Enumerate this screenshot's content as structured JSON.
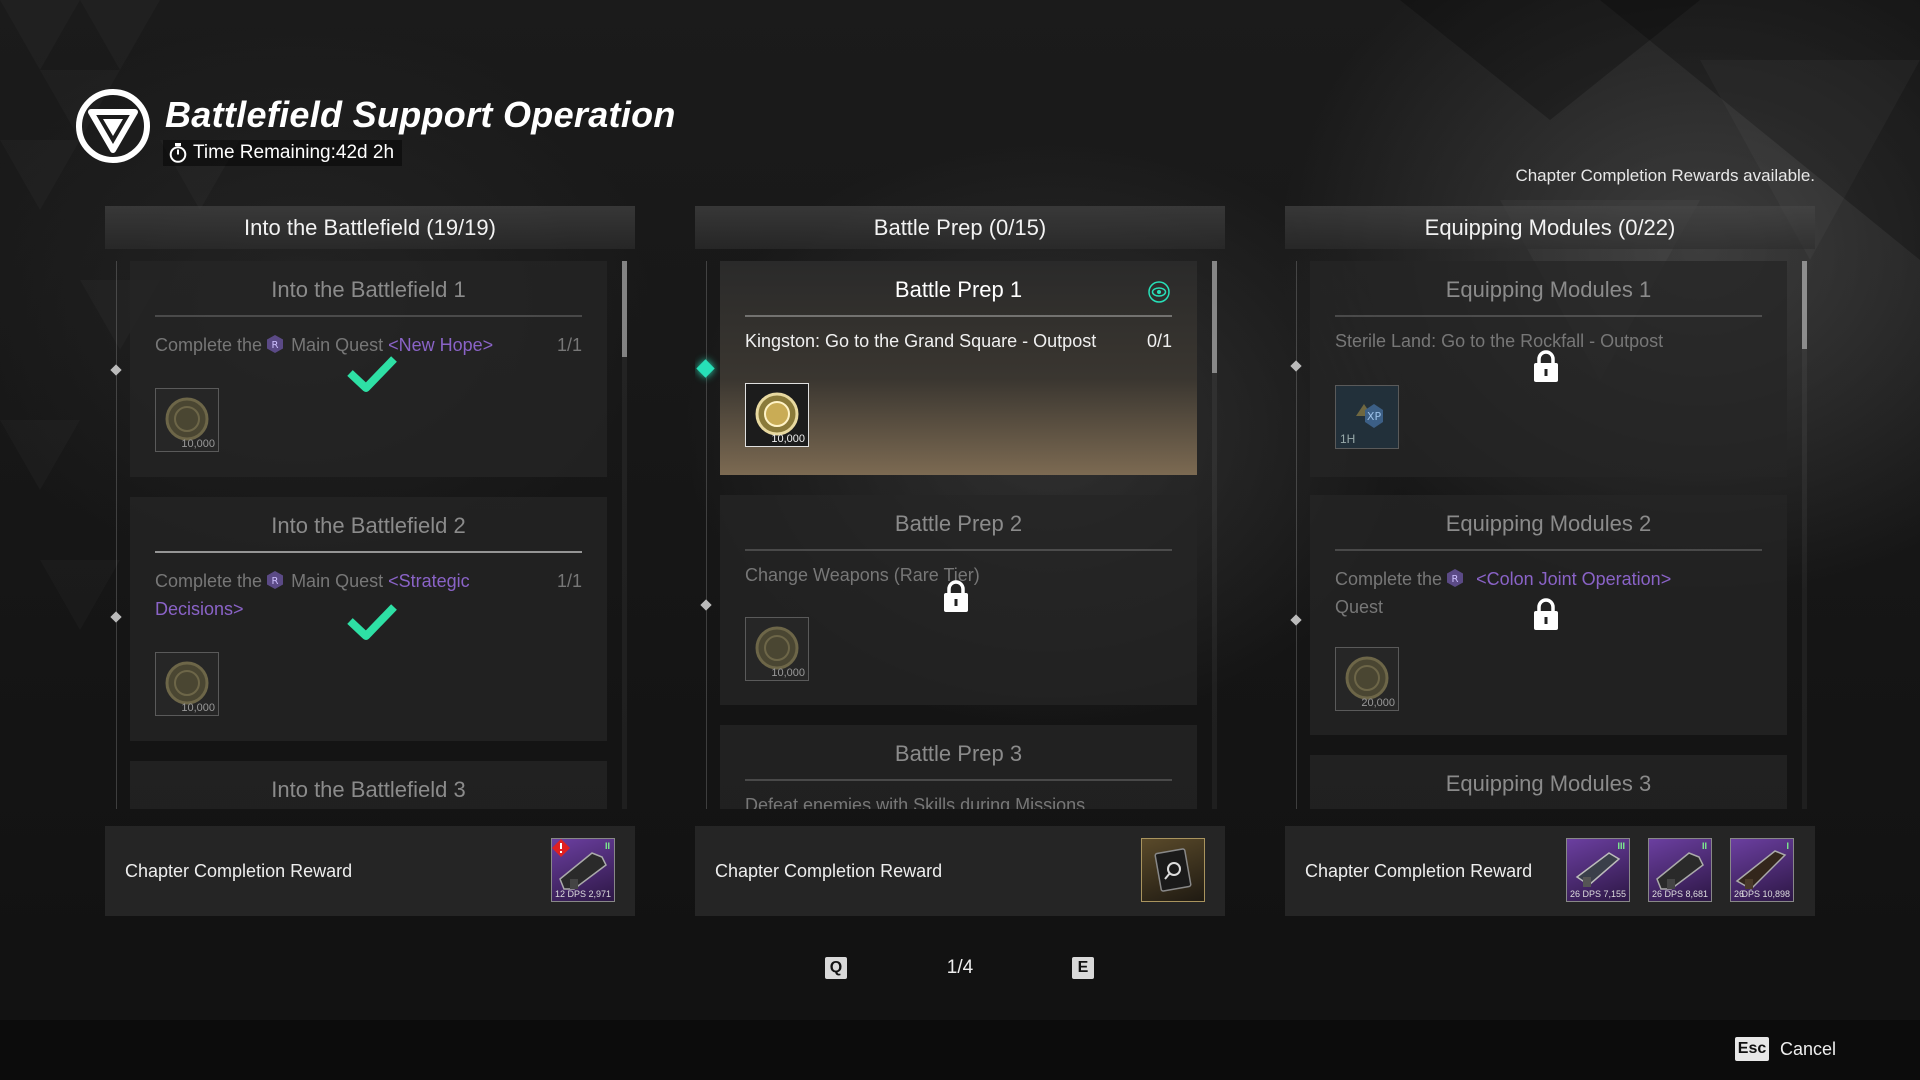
{
  "header": {
    "title": "Battlefield Support Operation",
    "time_remaining": "Time Remaining:42d 2h",
    "chapter_note": "Chapter Completion Rewards available."
  },
  "columns": [
    {
      "header": "Into the Battlefield  (19/19)",
      "scroll_position": 0.0,
      "quests": [
        {
          "title": "Into the Battlefield 1",
          "desc_prefix": "Complete the",
          "desc_mid": "Main Quest",
          "quest_name": "<New Hope>",
          "count": "1/1",
          "status": "completed",
          "reward": "gold-coin",
          "reward_amount": "10,000"
        },
        {
          "title": "Into the Battlefield 2",
          "desc_prefix": "Complete the",
          "desc_mid": "Main Quest",
          "quest_name": "<Strategic Decisions>",
          "count": "1/1",
          "status": "completed",
          "reward": "gold-coin",
          "reward_amount": "10,000"
        },
        {
          "title": "Into the Battlefield 3",
          "status": "partially-visible"
        }
      ],
      "footer": {
        "label": "Chapter Completion Reward",
        "items": [
          {
            "icon": "weapon-icon",
            "rarity": "rare",
            "level": "12",
            "dps": "DPS 2,971",
            "tier": "II",
            "alert": "new-badge-icon"
          }
        ]
      }
    },
    {
      "header": "Battle Prep  (0/15)",
      "scroll_position": 0.0,
      "quests": [
        {
          "title": "Battle Prep 1",
          "desc": "Kingston: Go to the Grand Square - Outpost",
          "count": "0/1",
          "status": "active-selected",
          "tracked": "eye-icon",
          "reward": "gold-coin",
          "reward_amount": "10,000"
        },
        {
          "title": "Battle Prep 2",
          "desc": "Change Weapons (Rare Tier)",
          "status": "locked",
          "reward": "gold-coin",
          "reward_amount": "10,000"
        },
        {
          "title": "Battle Prep 3",
          "desc": "Defeat enemies with Skills during Missions",
          "status": "locked"
        }
      ],
      "footer": {
        "label": "Chapter Completion Reward",
        "items": [
          {
            "icon": "decoration-item-icon",
            "rarity": "gold"
          }
        ]
      }
    },
    {
      "header": "Equipping Modules  (0/22)",
      "scroll_position": 0.0,
      "quests": [
        {
          "title": "Equipping Modules 1",
          "desc": "Sterile Land: Go to the Rockfall - Outpost",
          "status": "locked",
          "reward": "xp-boost",
          "reward_amount": "1H"
        },
        {
          "title": "Equipping Modules 2",
          "desc_prefix": "Complete the",
          "quest_name": "<Colon Joint Operation>",
          "desc_suffix": "Quest",
          "status": "locked",
          "reward": "gold-coin",
          "reward_amount": "20,000"
        },
        {
          "title": "Equipping Modules 3",
          "status": "partially-visible"
        }
      ],
      "footer": {
        "label": "Chapter Completion Reward",
        "items": [
          {
            "icon": "weapon-icon",
            "rarity": "rare",
            "level": "26",
            "dps": "DPS 7,155",
            "tier": "III"
          },
          {
            "icon": "weapon-icon",
            "rarity": "rare",
            "level": "26",
            "dps": "DPS 8,681",
            "tier": "II"
          },
          {
            "icon": "weapon-icon",
            "rarity": "rare",
            "level": "26",
            "dps": "DPS 10,898",
            "tier": "I"
          }
        ]
      }
    }
  ],
  "pager": {
    "prev_key": "Q",
    "page": "1/4",
    "next_key": "E"
  },
  "bottom": {
    "esc_key": "Esc",
    "cancel_label": "Cancel"
  },
  "colors": {
    "accent": "#27e0b8",
    "quest_name": "#8a63c7",
    "rare": "#6b3fa0",
    "check": "#2ee0a5"
  }
}
